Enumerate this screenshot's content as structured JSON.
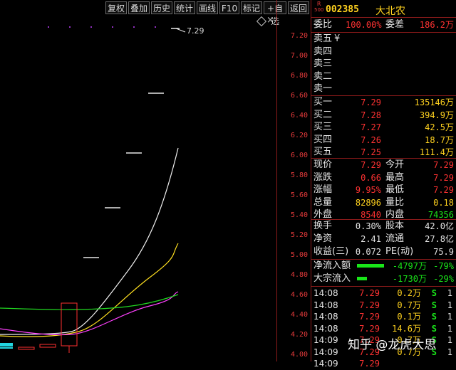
{
  "toolbar": [
    "复权",
    "叠加",
    "历史",
    "统计",
    "画线",
    "F10",
    "标记",
    "+自选",
    "返回"
  ],
  "chart": {
    "last_price_label": "7.29",
    "settings_icon": "diamond-icon",
    "close_icon": "close-icon",
    "axis_ticks": [
      "7.20",
      "7.00",
      "6.80",
      "6.60",
      "6.40",
      "6.20",
      "6.00",
      "5.80",
      "5.60",
      "5.40",
      "5.20",
      "5.00",
      "4.80",
      "4.60",
      "4.40",
      "4.20",
      "4.00"
    ]
  },
  "stock": {
    "flag_top": "R",
    "flag_bottom": "500",
    "code": "002385",
    "name": "大北农"
  },
  "weibi": {
    "label": "委比",
    "value": "100.00%",
    "label2": "委差",
    "value2": "186.2万"
  },
  "asks": [
    {
      "label": "卖五",
      "mark": "¥",
      "price": "",
      "vol": ""
    },
    {
      "label": "卖四",
      "mark": "",
      "price": "",
      "vol": ""
    },
    {
      "label": "卖三",
      "mark": "",
      "price": "",
      "vol": ""
    },
    {
      "label": "卖二",
      "mark": "",
      "price": "",
      "vol": ""
    },
    {
      "label": "卖一",
      "mark": "",
      "price": "",
      "vol": ""
    }
  ],
  "bids": [
    {
      "label": "买一",
      "price": "7.29",
      "vol": "135146万"
    },
    {
      "label": "买二",
      "price": "7.28",
      "vol": "394.9万"
    },
    {
      "label": "买三",
      "price": "7.27",
      "vol": "42.5万"
    },
    {
      "label": "买四",
      "price": "7.26",
      "vol": "18.7万"
    },
    {
      "label": "买五",
      "price": "7.25",
      "vol": "111.4万"
    }
  ],
  "stats1": [
    {
      "l1": "现价",
      "v1": "7.29",
      "c1": "red",
      "l2": "今开",
      "v2": "7.29",
      "c2": "red"
    },
    {
      "l1": "涨跌",
      "v1": "0.66",
      "c1": "red",
      "l2": "最高",
      "v2": "7.29",
      "c2": "red"
    },
    {
      "l1": "涨幅",
      "v1": "9.95%",
      "c1": "red",
      "l2": "最低",
      "v2": "7.29",
      "c2": "red"
    },
    {
      "l1": "总量",
      "v1": "82896",
      "c1": "yel",
      "l2": "量比",
      "v2": "0.18",
      "c2": "yel"
    },
    {
      "l1": "外盘",
      "v1": "8540",
      "c1": "red",
      "l2": "内盘",
      "v2": "74356",
      "c2": "grn"
    }
  ],
  "stats2": [
    {
      "l1": "换手",
      "v1": "0.30%",
      "l2": "股本",
      "v2": "42.0亿"
    },
    {
      "l1": "净资",
      "v1": "2.41",
      "l2": "流通",
      "v2": "27.8亿"
    },
    {
      "l1": "收益(三)",
      "v1": "0.072",
      "l2": "PE(动)",
      "v2": "75.9"
    }
  ],
  "flows": [
    {
      "label": "净流入额",
      "amount": "-4797万",
      "pct": "-79%",
      "bar": 0.79
    },
    {
      "label": "大宗流入",
      "amount": "-1730万",
      "pct": "-29%",
      "bar": 0.29
    }
  ],
  "ticks": [
    {
      "time": "14:08",
      "price": "7.29",
      "vol": "0.2万",
      "side": "S",
      "n": "1"
    },
    {
      "time": "14:08",
      "price": "7.29",
      "vol": "0.7万",
      "side": "S",
      "n": "1"
    },
    {
      "time": "14:08",
      "price": "7.29",
      "vol": "0.1万",
      "side": "S",
      "n": "1"
    },
    {
      "time": "14:08",
      "price": "7.29",
      "vol": "14.6万",
      "side": "S",
      "n": "1"
    },
    {
      "time": "14:09",
      "price": "7.29",
      "vol": "0.7万",
      "side": "S",
      "n": "1"
    },
    {
      "time": "14:09",
      "price": "7.29",
      "vol": "0.7万",
      "side": "S",
      "n": "1"
    },
    {
      "time": "14:09",
      "price": "7.29",
      "vol": "",
      "side": "",
      "n": ""
    }
  ],
  "watermark": "知乎 @龙虎大思"
}
